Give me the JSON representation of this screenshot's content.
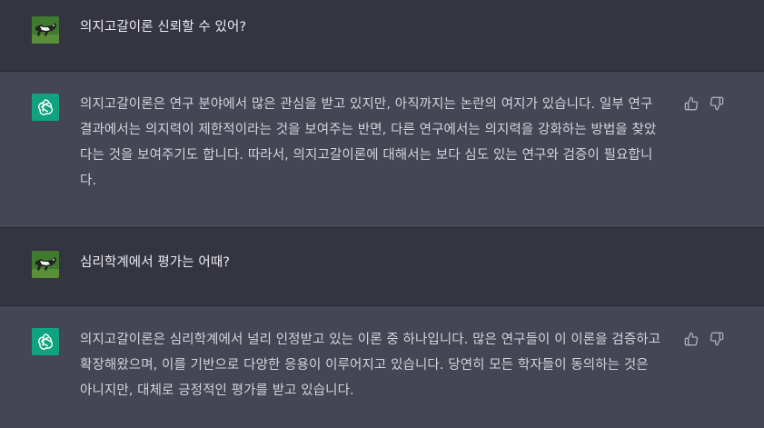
{
  "conversation": {
    "messages": [
      {
        "role": "user",
        "text_lines": [
          "의지고갈이론 신뢰할 수 있어?"
        ]
      },
      {
        "role": "assistant",
        "text_lines": [
          "의지고갈이론은 연구 분야에서 많은 관심을 받고 있지만, 아직까지는 논란의 여지가 있습니다. 일부 연구",
          "결과에서는 의지력이 제한적이라는 것을 보여주는 반면, 다른 연구에서는 의지력을 강화하는 방법을 찾았",
          "다는 것을 보여주기도 합니다. 따라서, 의지고갈이론에 대해서는 보다 심도 있는 연구와 검증이 필요합니",
          "다."
        ]
      },
      {
        "role": "user",
        "text_lines": [
          "심리학계에서 평가는 어때?"
        ]
      },
      {
        "role": "assistant",
        "text_lines": [
          "의지고갈이론은 심리학계에서 널리 인정받고 있는 이론 중 하나입니다. 많은 연구들이 이 이론을 검증하고",
          "확장해왔으며, 이를 기반으로 다양한 응용이 이루어지고 있습니다. 당연히 모든 학자들이 동의하는 것은",
          "아니지만, 대체로 긍정적인 평가를 받고 있습니다."
        ]
      }
    ]
  },
  "colors": {
    "user_bg": "#343541",
    "assistant_bg": "#444654",
    "bot_avatar": "#10a37f",
    "text": "#ececf1",
    "assistant_text": "#d1d5db",
    "icon": "#acacbe"
  },
  "icons": {
    "thumbs_up": "thumbs-up-icon",
    "thumbs_down": "thumbs-down-icon",
    "bot_logo": "openai-logo-icon",
    "user_avatar": "dog-avatar"
  }
}
